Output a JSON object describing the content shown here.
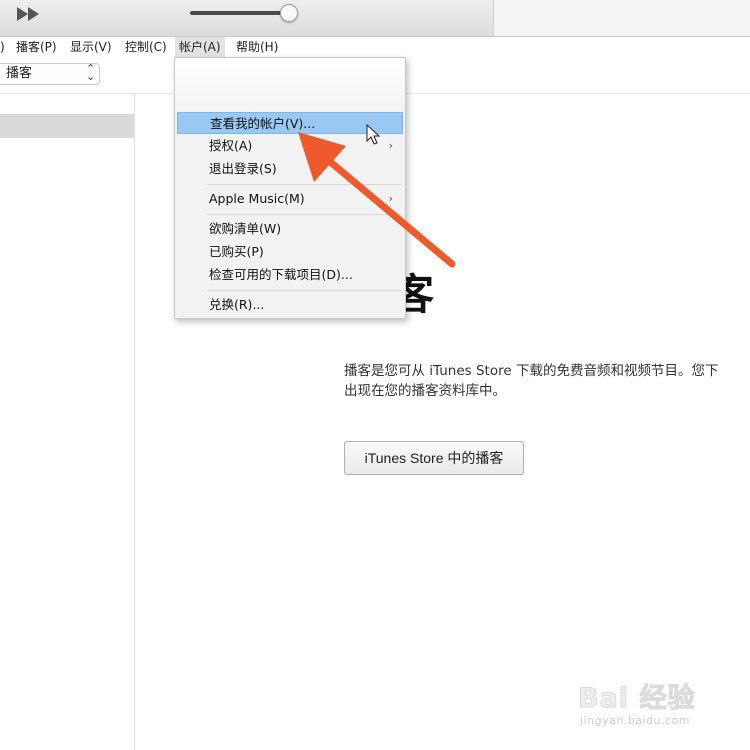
{
  "menubar": {
    "items": [
      {
        "label": ")"
      },
      {
        "label": "播客(P)"
      },
      {
        "label": "显示(V)"
      },
      {
        "label": "控制(C)"
      },
      {
        "label": "帐户(A)"
      },
      {
        "label": "帮助(H)"
      }
    ]
  },
  "toolbar": {
    "media_select": {
      "value": "播客",
      "icon": "up-down-chevron-icon"
    }
  },
  "account_menu": {
    "items": [
      {
        "label": "查看我的帐户(V)...",
        "highlighted": true
      },
      {
        "label": "授权(A)",
        "submenu": true
      },
      {
        "label": "退出登录(S)"
      },
      {
        "label": "Apple Music(M)",
        "submenu": true
      },
      {
        "label": "欲购清单(W)"
      },
      {
        "label": "已购买(P)"
      },
      {
        "label": "检查可用的下载项目(D)..."
      },
      {
        "label": "兑换(R)..."
      }
    ],
    "submenu_glyph": "›"
  },
  "content": {
    "title_fragment": "客",
    "description_line1": "播客是您可从 iTunes Store 下载的免费音频和视频节目。您下",
    "description_line2": "出现在您的播客资料库中。",
    "store_button_label": "iTunes Store 中的播客"
  },
  "watermark": {
    "logo_text": "Bai 经验",
    "url": "jingyan.baidu.com"
  },
  "colors": {
    "highlight": "#99c9f3",
    "annotation_arrow": "#ee5a2c"
  }
}
